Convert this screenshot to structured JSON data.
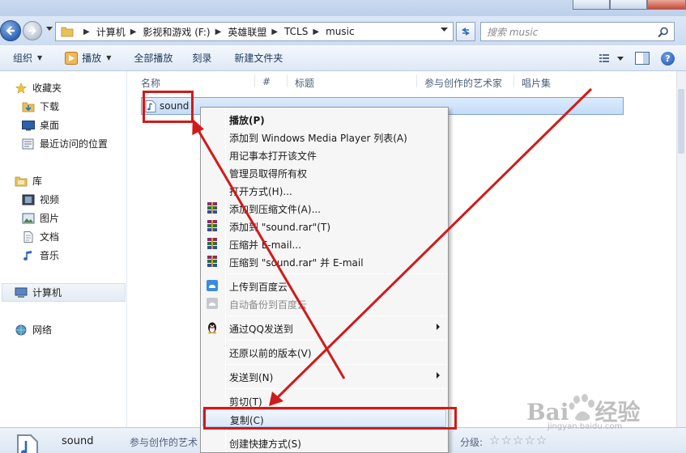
{
  "address": {
    "crumbs": [
      "计算机",
      "影视和游戏 (F:)",
      "英雄联盟",
      "TCLS",
      "music"
    ],
    "search_placeholder": "搜索 music"
  },
  "toolbar": {
    "organize": "组织",
    "play": "播放",
    "play_all": "全部播放",
    "burn": "刻录",
    "new_folder": "新建文件夹"
  },
  "nav": {
    "favorites": "收藏夹",
    "downloads": "下载",
    "desktop": "桌面",
    "recent": "最近访问的位置",
    "libraries": "库",
    "videos": "视频",
    "pictures": "图片",
    "documents": "文档",
    "music": "音乐",
    "computer": "计算机",
    "network": "网络"
  },
  "columns": {
    "name": "名称",
    "number": "#",
    "title": "标题",
    "artists": "参与创作的艺术家",
    "album": "唱片集"
  },
  "file": {
    "name": "sound"
  },
  "context_menu": [
    {
      "label": "播放(P)",
      "bold": true
    },
    {
      "label": "添加到 Windows Media Player 列表(A)"
    },
    {
      "label": "用记事本打开该文件"
    },
    {
      "label": "管理员取得所有权"
    },
    {
      "label": "打开方式(H)..."
    },
    {
      "label": "添加到压缩文件(A)..."
    },
    {
      "label": "添加到 \"sound.rar\"(T)"
    },
    {
      "label": "压缩并 E-mail..."
    },
    {
      "label": "压缩到 \"sound.rar\" 并 E-mail"
    },
    {
      "label": "上传到百度云"
    },
    {
      "label": "自动备份到百度云"
    },
    {
      "label": "通过QQ发送到"
    },
    {
      "label": "还原以前的版本(V)"
    },
    {
      "label": "发送到(N)"
    },
    {
      "label": "剪切(T)"
    },
    {
      "label": "复制(C)"
    },
    {
      "label": "创建快捷方式(S)"
    }
  ],
  "details": {
    "name": "sound",
    "artists_label": "参与创作的艺术",
    "rating_label": "分级:",
    "stars": "☆☆☆☆☆"
  },
  "watermark": {
    "logo": "Bai",
    "logo2": "经验",
    "url": "jingyan.baidu.com"
  },
  "colors": {
    "annotation_red": "#d11a1a",
    "selection_blue": "#c4dcf8"
  }
}
